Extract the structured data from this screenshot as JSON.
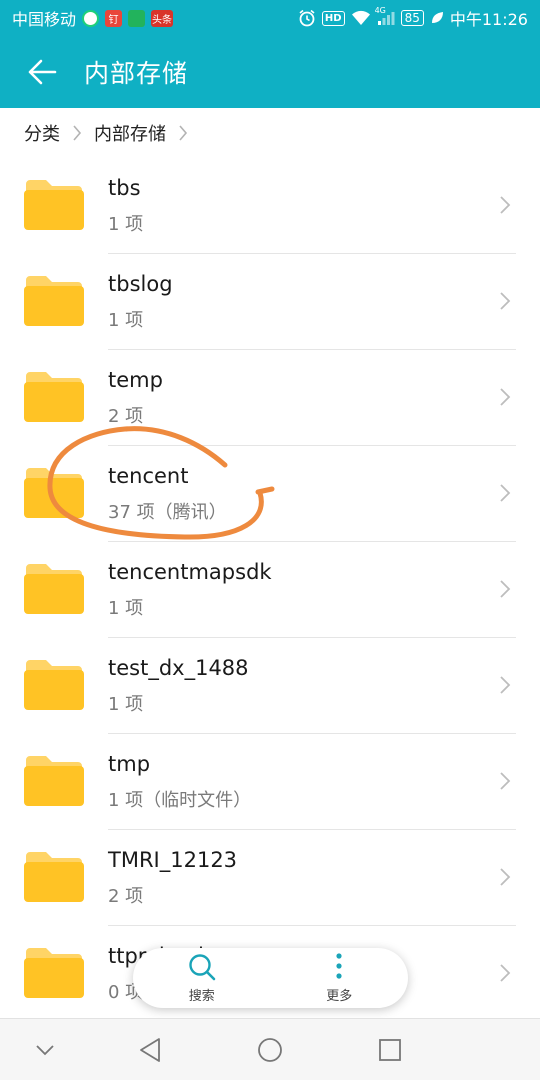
{
  "status_bar": {
    "carrier": "中国移动",
    "app_badges": [
      "",
      "钉",
      "",
      "头条"
    ],
    "hd": "HD",
    "network": "4G",
    "battery": "85",
    "time": "中午11:26"
  },
  "app_bar": {
    "title": "内部存储"
  },
  "breadcrumb": [
    {
      "label": "分类"
    },
    {
      "label": "内部存储"
    }
  ],
  "files": [
    {
      "name": "tbs",
      "meta": "1 项"
    },
    {
      "name": "tbslog",
      "meta": "1 项"
    },
    {
      "name": "temp",
      "meta": "2 项"
    },
    {
      "name": "tencent",
      "meta": "37 项（腾讯）"
    },
    {
      "name": "tencentmapsdk",
      "meta": "1 项"
    },
    {
      "name": "test_dx_1488",
      "meta": "1 项"
    },
    {
      "name": "tmp",
      "meta": "1 项（临时文件）"
    },
    {
      "name": "TMRI_12123",
      "meta": "2 项"
    },
    {
      "name": "ttpreload",
      "meta": "0 项"
    }
  ],
  "toolbar": {
    "search_label": "搜索",
    "more_label": "更多"
  },
  "colors": {
    "accent": "#0fb0c4",
    "folder": "#ffc325",
    "folder_tab": "#ffd466",
    "annotation": "#ee8a3e"
  }
}
